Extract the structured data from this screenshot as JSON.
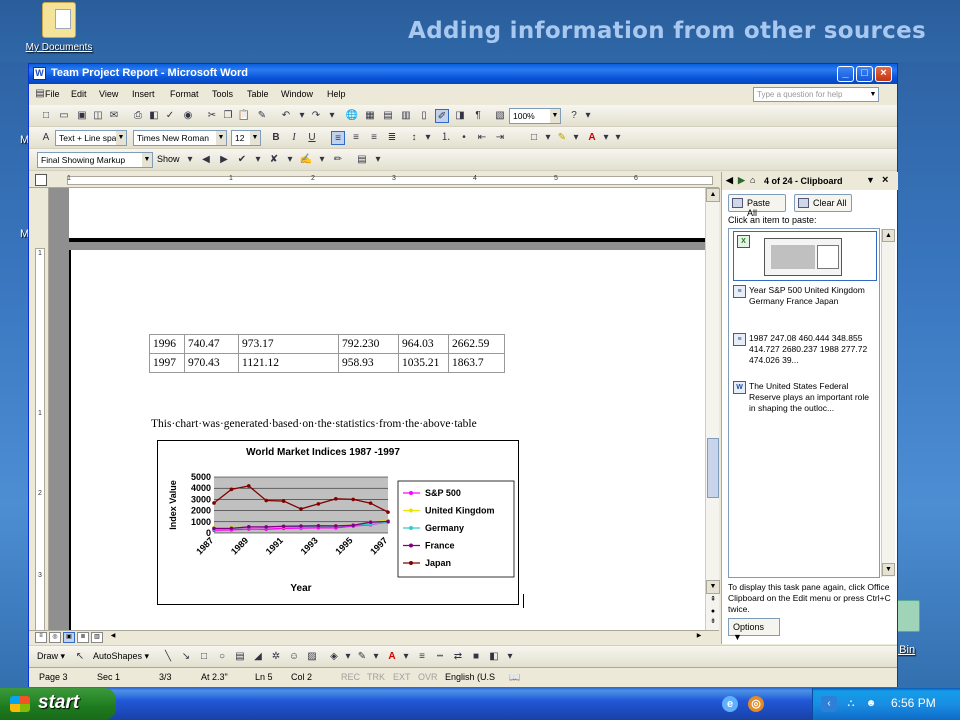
{
  "slide": {
    "title": "Adding information from other sources"
  },
  "desktop": {
    "my_documents": "My Documents",
    "recycle_bin": "e Bin",
    "frag_m1": "M",
    "frag_m2": "M"
  },
  "window": {
    "title": "Team Project Report - Microsoft Word"
  },
  "menu": [
    "File",
    "Edit",
    "View",
    "Insert",
    "Format",
    "Tools",
    "Table",
    "Window",
    "Help"
  ],
  "ask": {
    "placeholder": "Type a question for help"
  },
  "standard_toolbar": {
    "zoom": "100%"
  },
  "format_toolbar": {
    "style": "Text + Line spa",
    "font": "Times New Roman",
    "size": "12"
  },
  "review_toolbar": {
    "display": "Final Showing Markup",
    "show": "Show"
  },
  "ruler": {
    "numbers": [
      "1",
      "1",
      "2",
      "3",
      "4",
      "5",
      "6"
    ],
    "vnumbers": [
      "1",
      "1",
      "2",
      "3"
    ]
  },
  "table": {
    "rows": [
      [
        "1996",
        "740.47",
        "973.17",
        "792.230",
        "964.03",
        "2662.59"
      ],
      [
        "1997",
        "970.43",
        "1121.12",
        "958.93",
        "1035.21",
        "1863.7"
      ]
    ]
  },
  "caption": "This·chart·was·generated·based·on·the·statistics·from·the·above·table",
  "chart_data": {
    "type": "line",
    "title": "World Market Indices 1987 -1997",
    "xlabel": "Year",
    "ylabel": "Index Value",
    "categories": [
      "1987",
      "1988",
      "1989",
      "1990",
      "1991",
      "1992",
      "1993",
      "1994",
      "1995",
      "1996",
      "1997"
    ],
    "x_tick_labels": [
      "1987",
      "1989",
      "1991",
      "1993",
      "1995",
      "1997"
    ],
    "yticks": [
      "0",
      "1000",
      "2000",
      "3000",
      "4000",
      "5000"
    ],
    "ylim": [
      0,
      5000
    ],
    "grid": true,
    "legend_position": "right",
    "series": [
      {
        "name": "S&P 500",
        "color": "#ff00ff",
        "values": [
          247,
          277,
          353,
          330,
          417,
          436,
          466,
          459,
          616,
          740,
          970
        ]
      },
      {
        "name": "United Kingdom",
        "color": "#e6e600",
        "values": [
          460,
          474,
          520,
          510,
          560,
          600,
          620,
          640,
          700,
          973,
          1121
        ]
      },
      {
        "name": "Germany",
        "color": "#33cccc",
        "values": [
          348,
          400,
          530,
          520,
          580,
          560,
          620,
          610,
          680,
          792,
          958
        ]
      },
      {
        "name": "France",
        "color": "#800080",
        "values": [
          414,
          420,
          550,
          540,
          600,
          620,
          640,
          630,
          690,
          964,
          1035
        ]
      },
      {
        "name": "Japan",
        "color": "#800000",
        "values": [
          2680,
          3900,
          4200,
          2900,
          2850,
          2150,
          2600,
          3050,
          3000,
          2662,
          1863
        ]
      }
    ]
  },
  "taskpane": {
    "title": "4 of 24 - Clipboard",
    "paste_all": "Paste All",
    "clear_all": "Clear All",
    "click_label": "Click an item to paste:",
    "items": [
      {
        "text": "Year S&P 500 United Kingdom Germany France Japan"
      },
      {
        "text": "1987 247.08 460.444 348.855 414.727 2680.237 1988 277.72 474.026 39..."
      },
      {
        "text": "The United States Federal Reserve plays an important role in shaping the outloc..."
      }
    ],
    "footer": "To display this task pane again, click Office Clipboard on the Edit menu or press Ctrl+C twice.",
    "options": "Options"
  },
  "drawbar": {
    "draw": "Draw",
    "autoshapes": "AutoShapes"
  },
  "status": {
    "page": "Page 3",
    "sec": "Sec 1",
    "pages": "3/3",
    "at": "At 2.3\"",
    "ln": "Ln 5",
    "col": "Col 2",
    "rec": "REC",
    "trk": "TRK",
    "ext": "EXT",
    "ovr": "OVR",
    "lang": "English (U.S"
  },
  "taskbar": {
    "start": "start",
    "clock": "6:56 PM"
  }
}
